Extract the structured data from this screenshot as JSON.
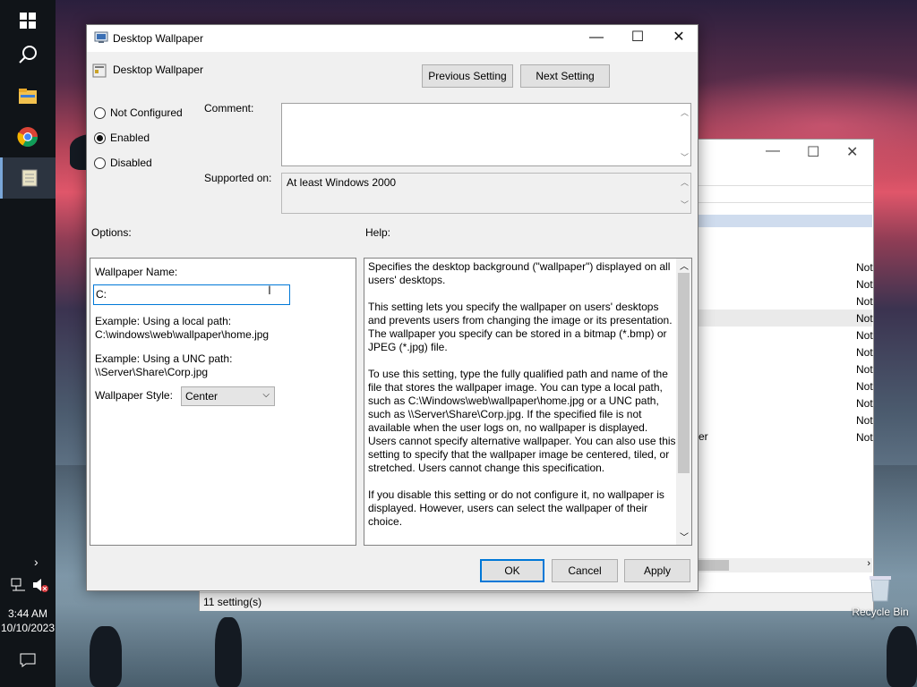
{
  "taskbar": {
    "icons": [
      "windows-start-icon",
      "search-icon",
      "file-explorer-icon",
      "chrome-icon",
      "notepad-icon"
    ],
    "time": "3:44 AM",
    "date": "10/10/2023"
  },
  "desktop": {
    "recycle_bin_label": "Recycle Bin"
  },
  "background_window": {
    "status_text": "11 setting(s)",
    "column_values": [
      "Not",
      "Not",
      "Not",
      "Not",
      "Not",
      "Not",
      "Not",
      "Not",
      "Not",
      "Not",
      "Not"
    ],
    "partial_text": "er"
  },
  "dialog": {
    "title": "Desktop Wallpaper",
    "setting_name": "Desktop Wallpaper",
    "previous_button": "Previous Setting",
    "next_button": "Next Setting",
    "radio": {
      "not_configured": "Not Configured",
      "enabled": "Enabled",
      "disabled": "Disabled",
      "selected": "enabled"
    },
    "comment_label": "Comment:",
    "comment_value": "",
    "supported_label": "Supported on:",
    "supported_value": "At least Windows 2000",
    "options_label": "Options:",
    "help_label": "Help:",
    "options": {
      "wallpaper_name_label": "Wallpaper Name:",
      "wallpaper_name_value": "C:",
      "example_local_1": "Example: Using a local path:",
      "example_local_2": "C:\\windows\\web\\wallpaper\\home.jpg",
      "example_unc_1": "Example: Using a UNC path:",
      "example_unc_2": "\\\\Server\\Share\\Corp.jpg",
      "style_label": "Wallpaper Style:",
      "style_value": "Center"
    },
    "help_paragraphs": [
      "Specifies the desktop background (\"wallpaper\") displayed on all users' desktops.",
      "This setting lets you specify the wallpaper on users' desktops and prevents users from changing the image or its presentation. The wallpaper you specify can be stored in a bitmap (*.bmp) or JPEG (*.jpg) file.",
      "To use this setting, type the fully qualified path and name of the file that stores the wallpaper image. You can type a local path, such as C:\\Windows\\web\\wallpaper\\home.jpg or a UNC path, such as \\\\Server\\Share\\Corp.jpg. If the specified file is not available when the user logs on, no wallpaper is displayed. Users cannot specify alternative wallpaper. You can also use this setting to specify that the wallpaper image be centered, tiled, or stretched. Users cannot change this specification.",
      "If you disable this setting or do not configure it, no wallpaper is displayed. However, users can select the wallpaper of their choice."
    ],
    "ok_button": "OK",
    "cancel_button": "Cancel",
    "apply_button": "Apply"
  }
}
